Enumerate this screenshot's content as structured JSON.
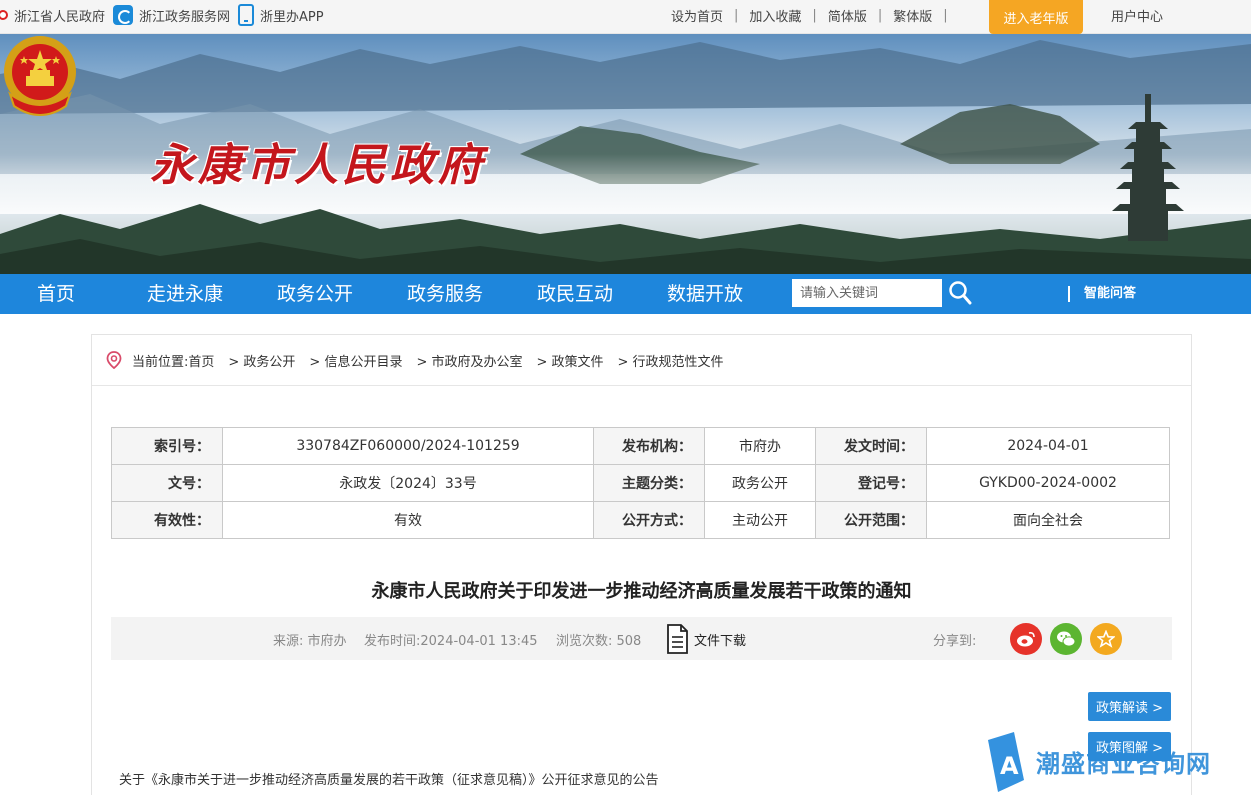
{
  "topbar": {
    "links_left": [
      "浙江省人民政府",
      "浙江政务服务网",
      "浙里办APP"
    ],
    "links_right": [
      "设为首页",
      "加入收藏",
      "简体版",
      "繁体版"
    ],
    "separator": "|",
    "elder_mode": "进入老年版",
    "user_center": "用户中心"
  },
  "header": {
    "site_title": "永康市人民政府"
  },
  "nav": {
    "items": [
      "首页",
      "走进永康",
      "政务公开",
      "政务服务",
      "政民互动",
      "数据开放"
    ],
    "search_placeholder": "请输入关键词",
    "smart_qa": "智能问答"
  },
  "breadcrumb": [
    "当前位置:首页",
    "> 政务公开",
    "> 信息公开目录",
    "> 市政府及办公室",
    "> 政策文件",
    "> 行政规范性文件"
  ],
  "meta": {
    "rows": [
      [
        {
          "k": "索引号：",
          "v": "330784ZF060000/2024-101259"
        },
        {
          "k": "发布机构：",
          "v": "市府办"
        },
        {
          "k": "发文时间：",
          "v": "2024-04-01"
        }
      ],
      [
        {
          "k": "文号：",
          "v": "永政发〔2024〕33号"
        },
        {
          "k": "主题分类：",
          "v": "政务公开"
        },
        {
          "k": "登记号：",
          "v": "GYKD00-2024-0002"
        }
      ],
      [
        {
          "k": "有效性：",
          "v": "有效"
        },
        {
          "k": "公开方式：",
          "v": "主动公开"
        },
        {
          "k": "公开范围：",
          "v": "面向全社会"
        }
      ]
    ]
  },
  "article": {
    "title": "永康市人民政府关于印发进一步推动经济高质量发展若干政策的通知",
    "source": "来源: 市府办",
    "published": "发布时间:2024-04-01 13:45",
    "views": "浏览次数: 508",
    "file_download": "文件下载",
    "share_label": "分享到:",
    "share_icons": [
      "weibo-icon",
      "wechat-icon",
      "favorite-icon"
    ],
    "policy_interpret": "政策解读 >",
    "policy_graphic": "政策图解 >",
    "notice_line": "关于《永康市关于进一步推动经济高质量发展的若干政策（征求意见稿）》公开征求意见的公告"
  },
  "watermark": {
    "text": "潮盛商业咨询网"
  },
  "colors": {
    "nav_blue": "#1e86dc",
    "elder_orange": "#f5a623",
    "title_red": "#c4161c",
    "weibo": "#e6332a",
    "wechat": "#5cb531",
    "favorite": "#f3a91f"
  }
}
